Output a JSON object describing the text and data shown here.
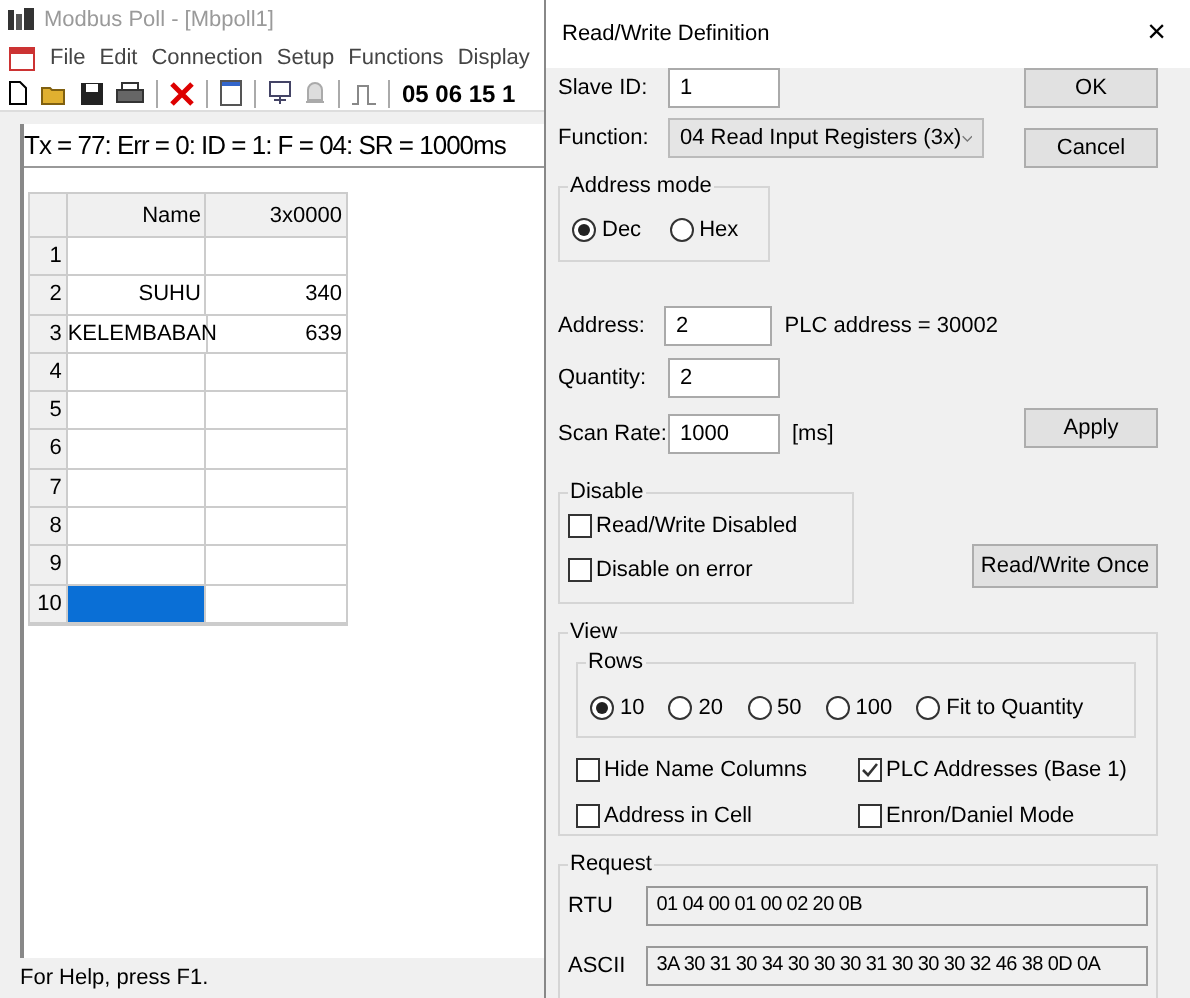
{
  "main_window": {
    "title": "Modbus Poll - [Mbpoll1]",
    "menu": [
      "File",
      "Edit",
      "Connection",
      "Setup",
      "Functions",
      "Display"
    ],
    "toolbar_text": "05 06 15 1",
    "doc_status": "Tx = 77: Err = 0: ID = 1: F = 04: SR = 1000ms",
    "table": {
      "columns": [
        "Name",
        "3x0000"
      ],
      "rows": [
        {
          "number": "1",
          "name": "",
          "value": "",
          "selected": false
        },
        {
          "number": "2",
          "name": "SUHU",
          "value": "340",
          "selected": false
        },
        {
          "number": "3",
          "name": "KELEMBABAN",
          "value": "639",
          "selected": false
        },
        {
          "number": "4",
          "name": "",
          "value": "",
          "selected": false
        },
        {
          "number": "5",
          "name": "",
          "value": "",
          "selected": false
        },
        {
          "number": "6",
          "name": "",
          "value": "",
          "selected": false
        },
        {
          "number": "7",
          "name": "",
          "value": "",
          "selected": false
        },
        {
          "number": "8",
          "name": "",
          "value": "",
          "selected": false
        },
        {
          "number": "9",
          "name": "",
          "value": "",
          "selected": false
        },
        {
          "number": "10",
          "name": "",
          "value": "",
          "selected": true
        }
      ]
    },
    "status_bar": "For Help, press F1."
  },
  "dialog": {
    "title": "Read/Write Definition",
    "close": "×",
    "slave_id": {
      "label": "Slave ID:",
      "value": "1"
    },
    "function": {
      "label": "Function:",
      "value": "04 Read Input Registers (3x)"
    },
    "address_mode": {
      "title": "Address mode",
      "options": [
        {
          "label": "Dec",
          "selected": true
        },
        {
          "label": "Hex",
          "selected": false
        }
      ]
    },
    "address": {
      "label": "Address:",
      "value": "2",
      "note": "PLC address = 30002"
    },
    "quantity": {
      "label": "Quantity:",
      "value": "2"
    },
    "scan_rate": {
      "label": "Scan Rate:",
      "value": "1000",
      "unit": "[ms]"
    },
    "buttons": {
      "ok": "OK",
      "cancel": "Cancel",
      "apply": "Apply",
      "once": "Read/Write Once"
    },
    "disable": {
      "title": "Disable",
      "options": [
        {
          "label": "Read/Write Disabled",
          "checked": false
        },
        {
          "label": "Disable on error",
          "checked": false
        }
      ]
    },
    "view": {
      "title": "View",
      "rows_title": "Rows",
      "rows": [
        {
          "label": "10",
          "selected": true
        },
        {
          "label": "20",
          "selected": false
        },
        {
          "label": "50",
          "selected": false
        },
        {
          "label": "100",
          "selected": false
        },
        {
          "label": "Fit to Quantity",
          "selected": false
        }
      ],
      "options": [
        {
          "label": "Hide Name Columns",
          "checked": false
        },
        {
          "label": "PLC Addresses (Base 1)",
          "checked": true
        },
        {
          "label": "Address in Cell",
          "checked": false
        },
        {
          "label": "Enron/Daniel Mode",
          "checked": false
        }
      ]
    },
    "request": {
      "title": "Request",
      "rtu_label": "RTU",
      "rtu": "01 04 00 01 00 02 20 0B",
      "ascii_label": "ASCII",
      "ascii": "3A 30 31 30 34 30 30 30 31 30 30 30 32 46 38 0D 0A"
    }
  }
}
